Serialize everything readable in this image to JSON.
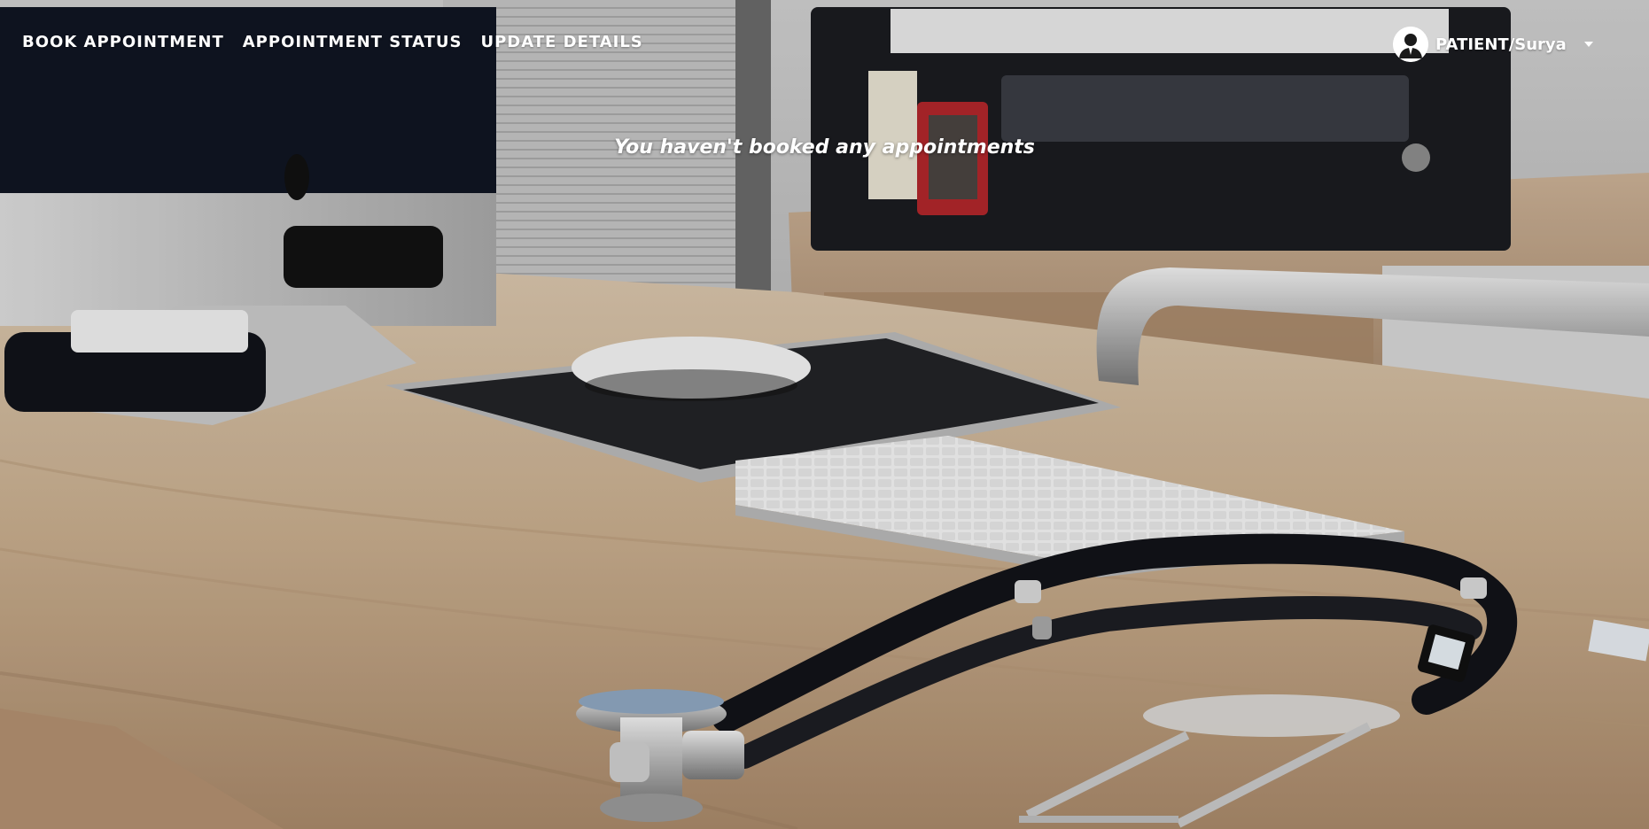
{
  "nav": {
    "links": [
      {
        "label": "BOOK APPOINTMENT"
      },
      {
        "label": "APPOINTMENT STATUS"
      },
      {
        "label": "UPDATE DETAILS"
      }
    ],
    "user": {
      "label": "PATIENT/Surya",
      "icon": "user-avatar-icon"
    }
  },
  "main": {
    "empty_message": "You haven't booked any appointments"
  },
  "background": {
    "icon": "office-desk-stethoscope-photo"
  },
  "colors": {
    "nav_text": "#ffffff",
    "desk": "#c9b39a"
  }
}
